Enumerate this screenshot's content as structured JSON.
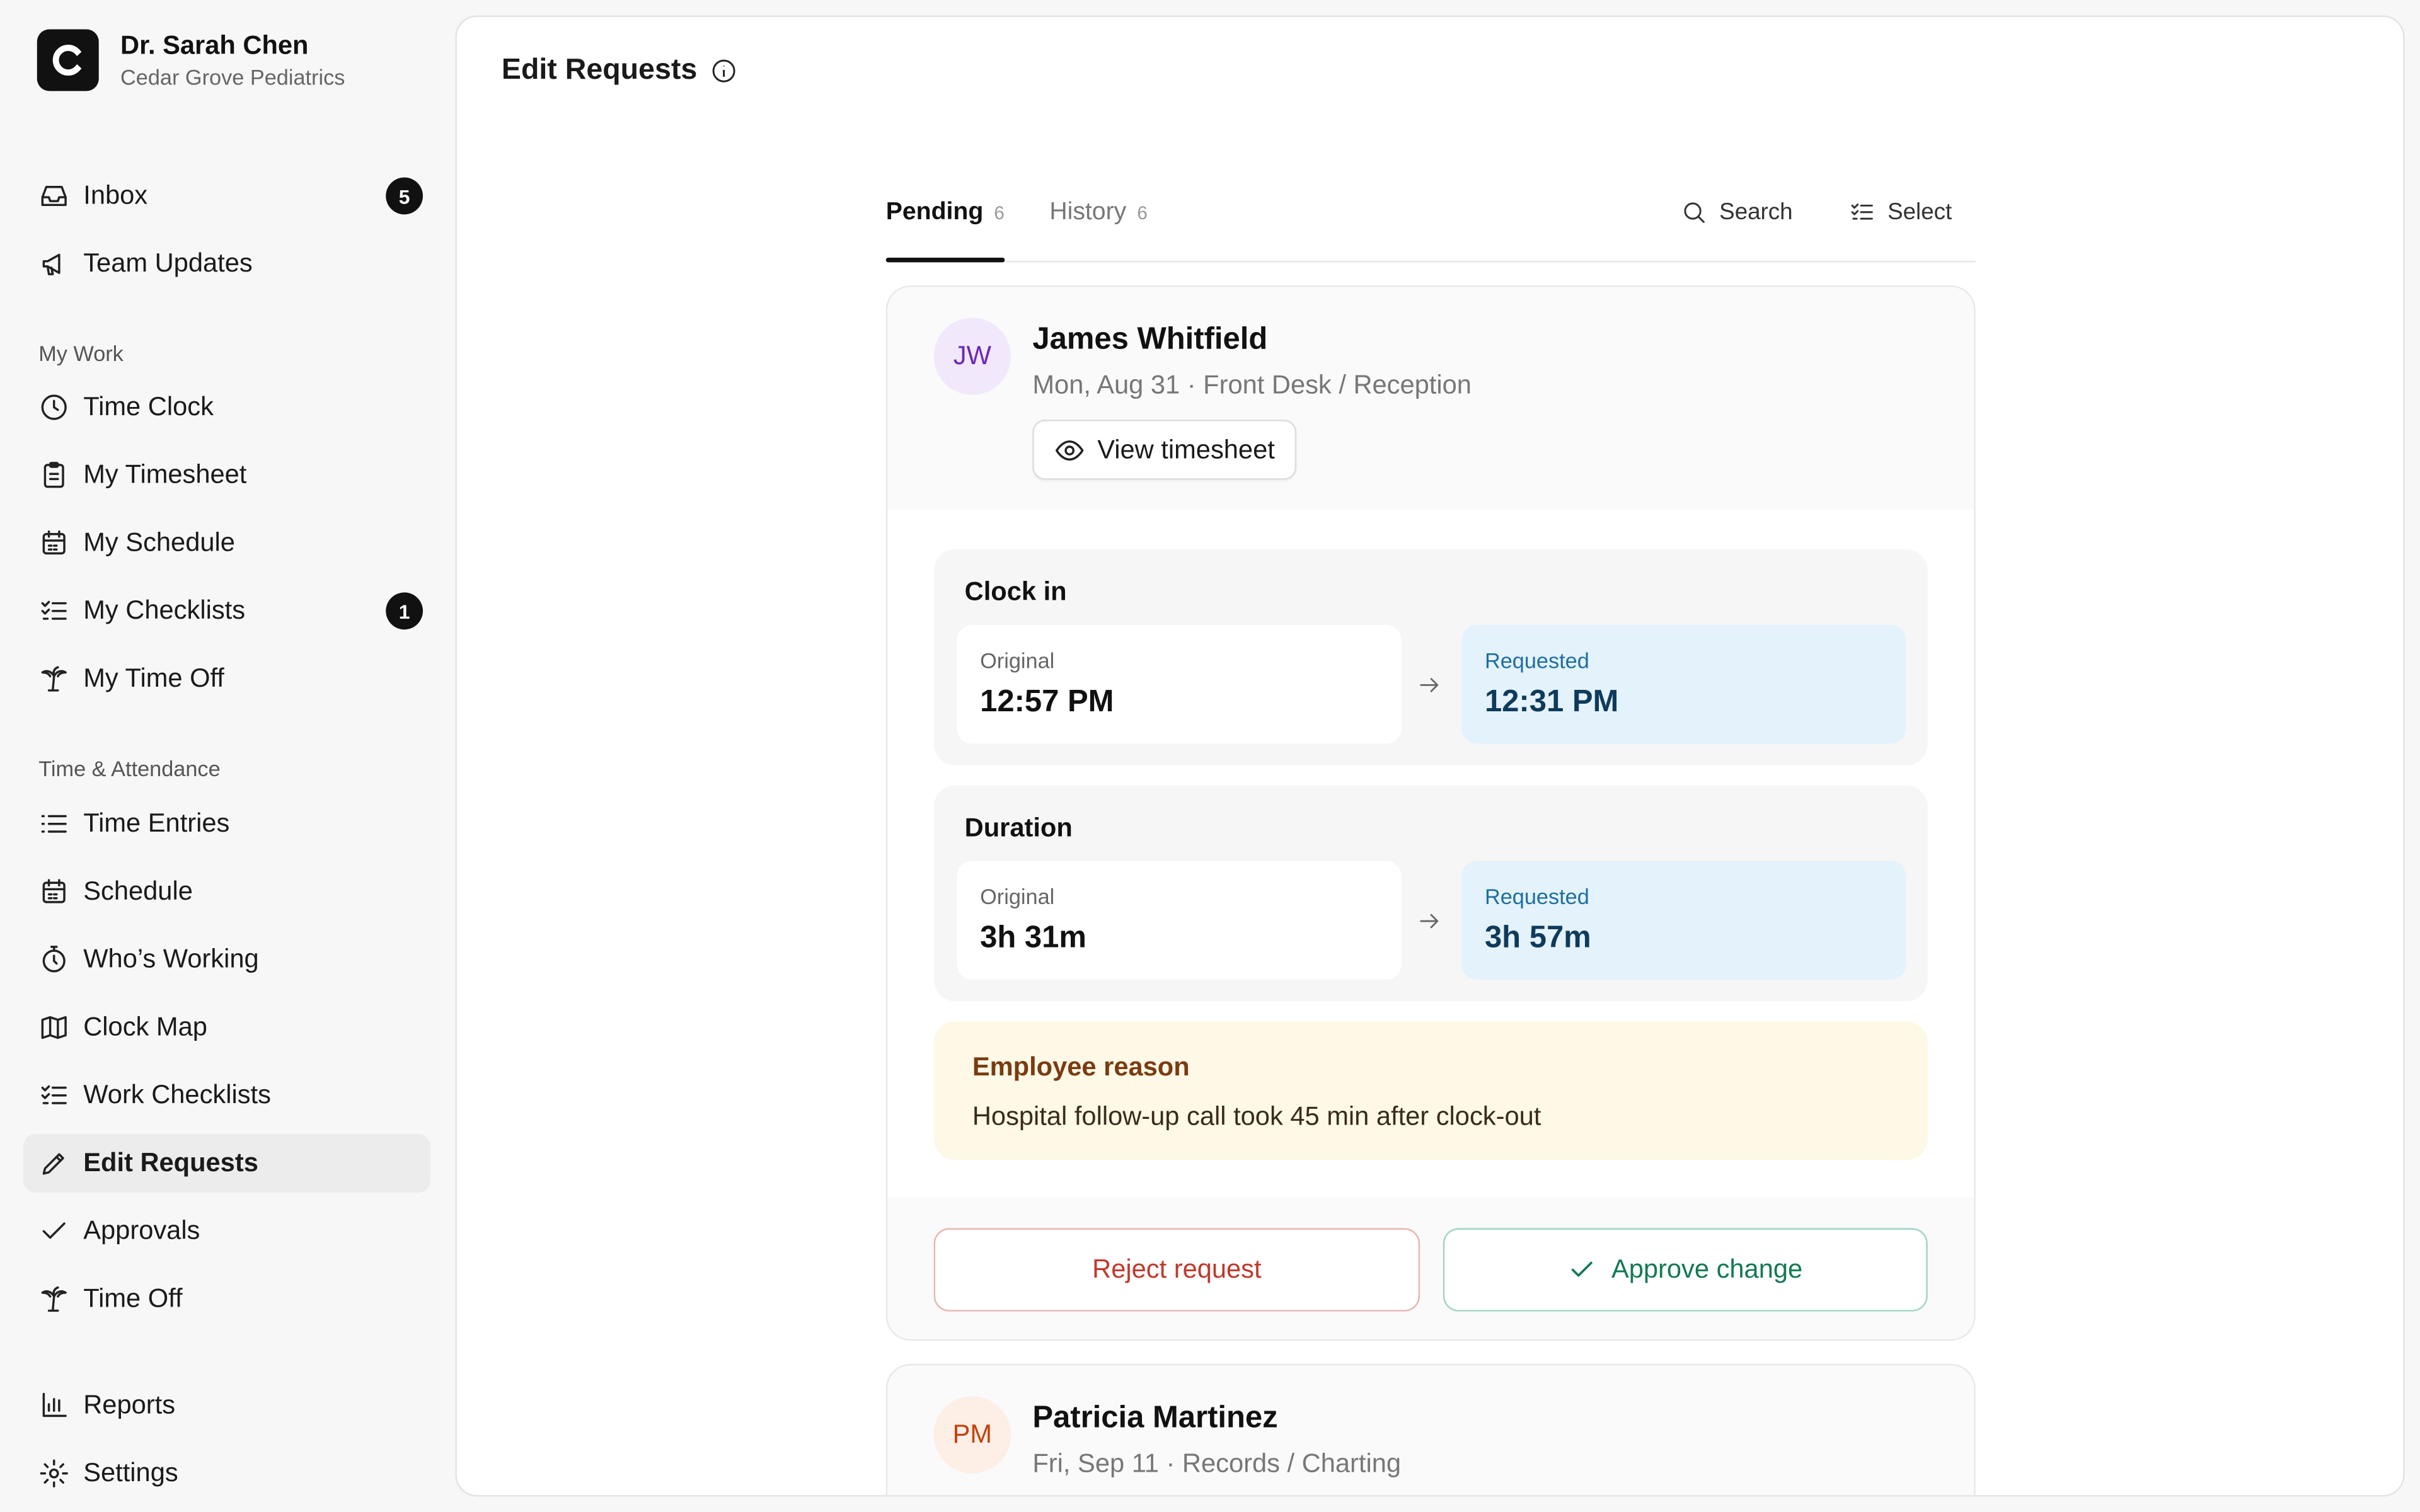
{
  "org": {
    "name": "Dr. Sarah Chen",
    "subtitle": "Cedar Grove Pediatrics"
  },
  "sidebar": {
    "top": [
      {
        "label": "Inbox",
        "icon": "inbox-icon",
        "badge": "5"
      },
      {
        "label": "Team Updates",
        "icon": "megaphone-icon"
      }
    ],
    "sections": [
      {
        "label": "My Work",
        "items": [
          {
            "label": "Time Clock",
            "icon": "clock-icon"
          },
          {
            "label": "My Timesheet",
            "icon": "clipboard-icon"
          },
          {
            "label": "My Schedule",
            "icon": "calendar-icon"
          },
          {
            "label": "My Checklists",
            "icon": "checklist-icon",
            "badge": "1"
          },
          {
            "label": "My Time Off",
            "icon": "palm-tree-icon"
          }
        ]
      },
      {
        "label": "Time & Attendance",
        "items": [
          {
            "label": "Time Entries",
            "icon": "list-icon"
          },
          {
            "label": "Schedule",
            "icon": "calendar-icon"
          },
          {
            "label": "Who’s Working",
            "icon": "stopwatch-icon"
          },
          {
            "label": "Clock Map",
            "icon": "map-icon"
          },
          {
            "label": "Work Checklists",
            "icon": "checklist-icon"
          },
          {
            "label": "Edit Requests",
            "icon": "pencil-icon",
            "active": true
          },
          {
            "label": "Approvals",
            "icon": "check-icon"
          },
          {
            "label": "Time Off",
            "icon": "palm-tree-icon"
          }
        ]
      }
    ],
    "bottom": [
      {
        "label": "Reports",
        "icon": "bar-chart-icon"
      },
      {
        "label": "Settings",
        "icon": "gear-icon"
      }
    ]
  },
  "page": {
    "title": "Edit Requests"
  },
  "tabs": [
    {
      "label": "Pending",
      "count": "6",
      "active": true
    },
    {
      "label": "History",
      "count": "6"
    }
  ],
  "toolbar": {
    "search_label": "Search",
    "select_label": "Select"
  },
  "requests": [
    {
      "initials": "JW",
      "name": "James Whitfield",
      "meta": "Mon, Aug 31 · Front Desk / Reception",
      "view_label": "View timesheet",
      "fields": [
        {
          "title": "Clock in",
          "original_label": "Original",
          "original": "12:57 PM",
          "requested_label": "Requested",
          "requested": "12:31 PM"
        },
        {
          "title": "Duration",
          "original_label": "Original",
          "original": "3h 31m",
          "requested_label": "Requested",
          "requested": "3h 57m"
        }
      ],
      "reason_title": "Employee reason",
      "reason": "Hospital follow-up call took 45 min after clock-out",
      "reject_label": "Reject request",
      "approve_label": "Approve change"
    },
    {
      "initials": "PM",
      "name": "Patricia Martinez",
      "meta": "Fri, Sep 11 · Records / Charting"
    }
  ]
}
